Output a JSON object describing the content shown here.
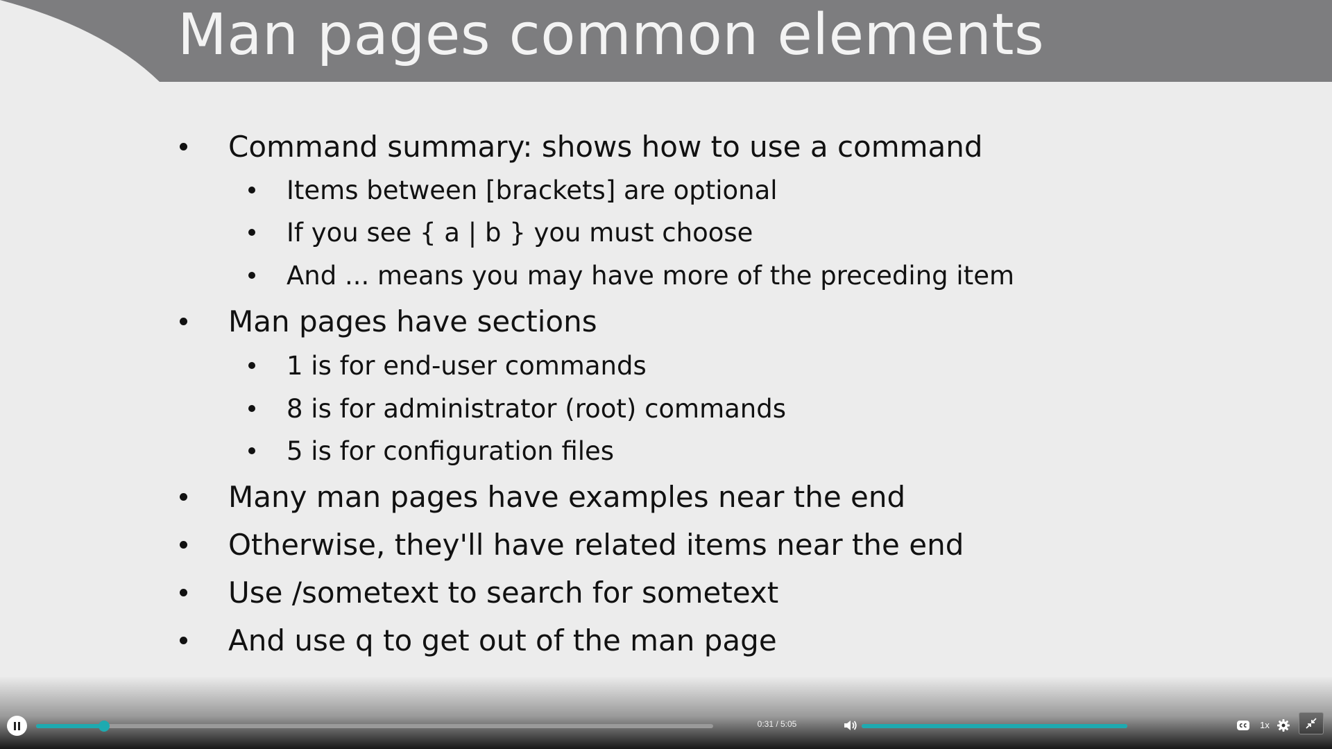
{
  "slide": {
    "title": "Man pages common elements",
    "bullets": [
      {
        "level": 1,
        "text": "Command summary: shows how to use a command"
      },
      {
        "level": 2,
        "text": "Items between [brackets] are optional"
      },
      {
        "level": 2,
        "text": "If you see { a | b } you must choose"
      },
      {
        "level": 2,
        "text": "And ... means you may have more of the preceding item"
      },
      {
        "level": 1,
        "text": "Man pages have sections"
      },
      {
        "level": 2,
        "text": "1 is for end-user commands"
      },
      {
        "level": 2,
        "text": "8 is for administrator (root) commands"
      },
      {
        "level": 2,
        "text": "5 is for configuration files"
      },
      {
        "level": 1,
        "text": "Many man pages have examples near the end"
      },
      {
        "level": 1,
        "text": "Otherwise, they'll have related items near the end"
      },
      {
        "level": 1,
        "text": "Use /sometext to search for sometext"
      },
      {
        "level": 1,
        "text": "And use q to get out of the man page"
      }
    ]
  },
  "player": {
    "time": "0:31 / 5:05",
    "progress_fraction": 0.1,
    "volume_fraction": 1.0,
    "speed_label": "1x",
    "accent_color": "#1eaab0",
    "icons": {
      "pause": "pause-icon",
      "volume": "volume-icon",
      "captions": "closed-captions-icon",
      "settings": "gear-icon",
      "fullscreen": "exit-fullscreen-icon"
    }
  },
  "colors": {
    "slide_background": "#ececec",
    "title_bar": "#7d7d7f",
    "title_text": "#f3f3f3",
    "body_text": "#111111"
  }
}
